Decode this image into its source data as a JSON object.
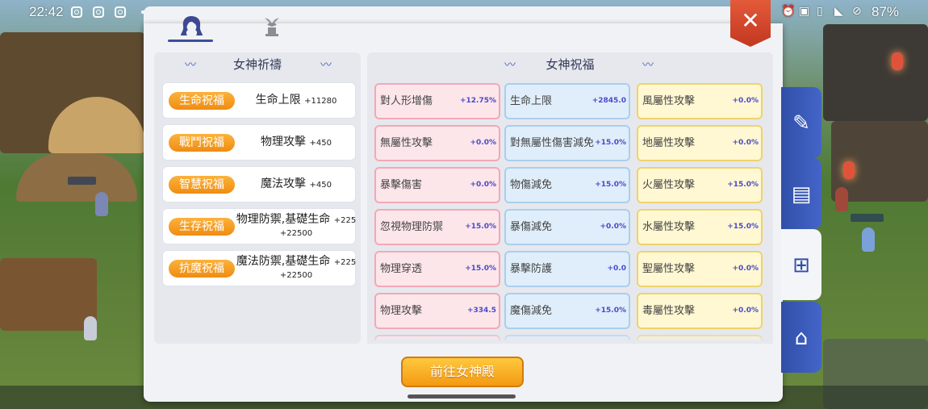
{
  "status_bar": {
    "time": "22:42",
    "battery": "87%"
  },
  "tabs": [
    {
      "icon": "goddess-portrait-icon",
      "active": true
    },
    {
      "icon": "goddess-statue-icon",
      "active": false
    }
  ],
  "left_panel": {
    "title": "女神祈禱",
    "blessings": [
      {
        "tag": "生命祝福",
        "text": "生命上限",
        "value": "+11280",
        "extra": ""
      },
      {
        "tag": "戰鬥祝福",
        "text": "物理攻擊",
        "value": "+450",
        "extra": ""
      },
      {
        "tag": "智慧祝福",
        "text": "魔法攻擊",
        "value": "+450",
        "extra": ""
      },
      {
        "tag": "生存祝福",
        "text": "物理防禦,基礎生命",
        "value": "+225",
        "extra": "+22500"
      },
      {
        "tag": "抗魔祝福",
        "text": "魔法防禦,基礎生命",
        "value": "+225",
        "extra": "+22500"
      }
    ]
  },
  "right_panel": {
    "title": "女神祝福",
    "columns": [
      [
        {
          "name": "對人形增傷",
          "value": "+12.75%"
        },
        {
          "name": "無屬性攻擊",
          "value": "+0.0%"
        },
        {
          "name": "暴擊傷害",
          "value": "+0.0%"
        },
        {
          "name": "忽視物理防禦",
          "value": "+15.0%"
        },
        {
          "name": "物理穿透",
          "value": "+15.0%"
        },
        {
          "name": "物理攻擊",
          "value": "+334.5"
        }
      ],
      [
        {
          "name": "生命上限",
          "value": "+2845.0"
        },
        {
          "name": "對無屬性傷害減免",
          "value": "+15.0%"
        },
        {
          "name": "物傷減免",
          "value": "+15.0%"
        },
        {
          "name": "暴傷減免",
          "value": "+0.0%"
        },
        {
          "name": "暴擊防護",
          "value": "+0.0"
        },
        {
          "name": "魔傷減免",
          "value": "+15.0%"
        }
      ],
      [
        {
          "name": "風屬性攻擊",
          "value": "+0.0%"
        },
        {
          "name": "地屬性攻擊",
          "value": "+0.0%"
        },
        {
          "name": "火屬性攻擊",
          "value": "+15.0%"
        },
        {
          "name": "水屬性攻擊",
          "value": "+15.0%"
        },
        {
          "name": "聖屬性攻擊",
          "value": "+0.0%"
        },
        {
          "name": "毒屬性攻擊",
          "value": "+0.0%"
        }
      ]
    ]
  },
  "button": {
    "label": "前往女神殿"
  },
  "close_label": "✕",
  "side_tabs": [
    {
      "icon": "edit-icon",
      "active": false
    },
    {
      "icon": "contacts-book-icon",
      "active": false
    },
    {
      "icon": "goddess-blessing-icon",
      "active": true
    },
    {
      "icon": "guild-home-icon",
      "active": false
    }
  ],
  "colors": {
    "accent_blue": "#2f4fa8",
    "tag_orange": "#f39a12",
    "cell_red": "#fde6ea",
    "cell_blue": "#dfeefa",
    "cell_yellow": "#fff8d2"
  }
}
